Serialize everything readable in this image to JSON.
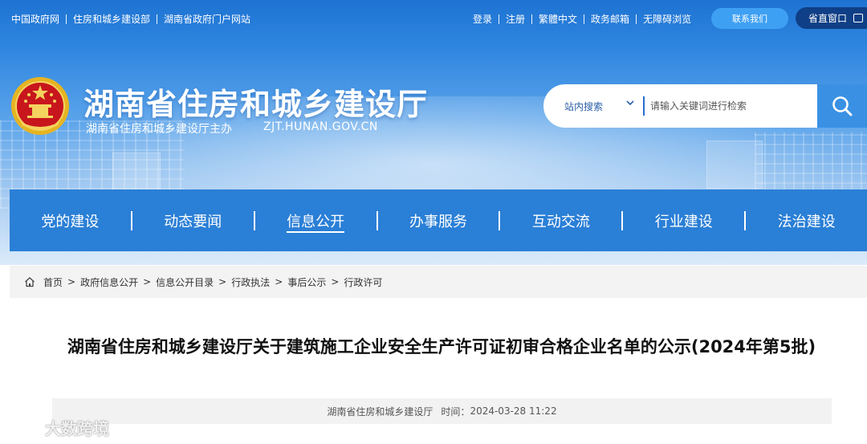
{
  "top_links_left": [
    "中国政府网",
    "住房和城乡建设部",
    "湖南省政府门户网站"
  ],
  "top_links_right": [
    "登录",
    "注册",
    "繁體中文",
    "政务邮箱",
    "无障碍浏览"
  ],
  "contact_label": "联系我们",
  "window_label": "省直窗口",
  "site": {
    "title": "湖南省住房和城乡建设厅",
    "subtitle": "湖南省住房和城乡建设厅主办",
    "url": "ZJT.HUNAN.GOV.CN"
  },
  "search": {
    "scope": "站内搜索",
    "placeholder": "请输入关键词进行检索"
  },
  "nav": [
    "党的建设",
    "动态要闻",
    "信息公开",
    "办事服务",
    "互动交流",
    "行业建设",
    "法治建设"
  ],
  "nav_active": "信息公开",
  "breadcrumb": [
    "首页",
    "政府信息公开",
    "信息公开目录",
    "行政执法",
    "事后公示",
    "行政许可"
  ],
  "article": {
    "title": "湖南省住房和城乡建设厅关于建筑施工企业安全生产许可证初审合格企业名单的公示(2024年第5批)",
    "source": "湖南省住房和城乡建设厅",
    "time_label": "时间：",
    "time": "2024-03-28 11:22"
  },
  "watermark": "大数跨境",
  "icons": {
    "emblem": "national-emblem-icon",
    "search": "search-icon",
    "home": "home-icon",
    "window": "window-icon",
    "chevron": "chevron-down-icon"
  },
  "colors": {
    "nav_bg": "#2a7fd6",
    "contact_bg": "#3ea0f3",
    "window_bg": "#0f3f86",
    "search_btn": "#3a91e4"
  }
}
